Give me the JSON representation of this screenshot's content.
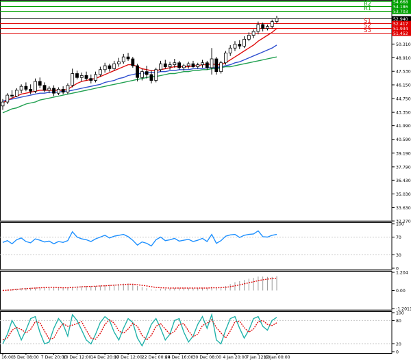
{
  "chart_data": {
    "type": "line",
    "main": {
      "type": "candlestick",
      "price_ticks": [
        "50.310",
        "48.910",
        "47.530",
        "46.150",
        "44.750",
        "43.350",
        "41.990",
        "40.590",
        "39.190",
        "37.790",
        "36.430",
        "35.030",
        "33.630",
        "32.270"
      ],
      "price_range": [
        32.27,
        54.8
      ],
      "levels": [
        {
          "name": "R3",
          "value": 54.668,
          "label": "54.668",
          "color": "#00a000"
        },
        {
          "name": "R2",
          "value": 54.186,
          "label": "54.186",
          "color": "#00a000"
        },
        {
          "name": "R1",
          "value": 53.703,
          "label": "53.703",
          "color": "#00a000"
        },
        {
          "name": "",
          "value": 52.94,
          "label": "52.940",
          "color": "#000000"
        },
        {
          "name": "S1",
          "value": 52.417,
          "label": "52.417",
          "color": "#e00000"
        },
        {
          "name": "S2",
          "value": 51.934,
          "label": "51.934",
          "color": "#e00000"
        },
        {
          "name": "S3",
          "value": 51.452,
          "label": "51.452",
          "color": "#e00000"
        }
      ],
      "candles": [
        [
          44.0,
          44.7,
          43.6,
          44.4
        ],
        [
          44.4,
          45.3,
          44.2,
          45.1
        ],
        [
          45.1,
          45.6,
          44.8,
          45.0
        ],
        [
          45.0,
          45.8,
          44.9,
          45.6
        ],
        [
          45.6,
          46.2,
          45.3,
          46.0
        ],
        [
          46.0,
          46.4,
          45.5,
          45.7
        ],
        [
          45.7,
          46.2,
          45.2,
          45.5
        ],
        [
          45.5,
          46.8,
          45.3,
          46.5
        ],
        [
          46.5,
          46.9,
          45.8,
          46.1
        ],
        [
          46.1,
          46.4,
          45.4,
          45.6
        ],
        [
          45.6,
          46.0,
          45.3,
          45.8
        ],
        [
          45.8,
          46.1,
          45.0,
          45.3
        ],
        [
          45.3,
          45.9,
          45.1,
          45.7
        ],
        [
          45.7,
          46.0,
          45.2,
          45.4
        ],
        [
          45.4,
          46.3,
          45.2,
          46.1
        ],
        [
          46.1,
          47.8,
          45.9,
          47.3
        ],
        [
          47.3,
          47.6,
          46.7,
          46.9
        ],
        [
          46.9,
          47.4,
          46.5,
          47.1
        ],
        [
          47.1,
          47.5,
          46.6,
          46.8
        ],
        [
          46.8,
          47.2,
          46.3,
          46.6
        ],
        [
          46.6,
          47.5,
          46.4,
          47.2
        ],
        [
          47.2,
          48.0,
          47.0,
          47.7
        ],
        [
          47.7,
          48.4,
          47.4,
          48.1
        ],
        [
          48.1,
          48.3,
          47.5,
          47.8
        ],
        [
          47.8,
          48.6,
          47.6,
          48.3
        ],
        [
          48.3,
          48.9,
          48.0,
          48.5
        ],
        [
          48.5,
          49.3,
          48.3,
          49.0
        ],
        [
          49.0,
          49.4,
          48.6,
          48.8
        ],
        [
          48.8,
          49.0,
          47.9,
          48.1
        ],
        [
          48.1,
          48.3,
          46.5,
          46.9
        ],
        [
          46.9,
          47.8,
          46.6,
          47.5
        ],
        [
          47.5,
          48.1,
          46.8,
          47.2
        ],
        [
          47.2,
          47.6,
          46.3,
          46.6
        ],
        [
          46.6,
          47.9,
          46.4,
          47.7
        ],
        [
          47.7,
          48.6,
          47.5,
          48.3
        ],
        [
          48.3,
          48.7,
          47.8,
          48.0
        ],
        [
          48.0,
          48.5,
          47.7,
          48.2
        ],
        [
          48.2,
          48.8,
          47.9,
          48.4
        ],
        [
          48.4,
          48.6,
          47.7,
          47.9
        ],
        [
          47.9,
          48.3,
          47.6,
          48.1
        ],
        [
          48.1,
          48.5,
          47.8,
          48.3
        ],
        [
          48.3,
          48.6,
          47.9,
          48.0
        ],
        [
          48.0,
          48.4,
          47.8,
          48.2
        ],
        [
          48.2,
          48.7,
          47.9,
          48.4
        ],
        [
          48.4,
          48.6,
          47.7,
          47.9
        ],
        [
          47.9,
          49.9,
          47.2,
          48.8
        ],
        [
          48.8,
          49.0,
          47.2,
          47.5
        ],
        [
          47.5,
          48.6,
          47.3,
          48.4
        ],
        [
          48.4,
          49.6,
          48.2,
          49.4
        ],
        [
          49.4,
          50.2,
          49.1,
          49.9
        ],
        [
          49.9,
          50.6,
          49.6,
          50.3
        ],
        [
          50.3,
          50.7,
          49.8,
          50.1
        ],
        [
          50.1,
          51.1,
          49.9,
          50.8
        ],
        [
          50.8,
          51.5,
          50.6,
          51.2
        ],
        [
          51.2,
          51.8,
          50.9,
          51.6
        ],
        [
          51.6,
          52.6,
          51.3,
          52.3
        ],
        [
          52.3,
          52.5,
          51.6,
          51.9
        ],
        [
          51.9,
          52.3,
          51.7,
          52.1
        ],
        [
          52.1,
          52.8,
          51.9,
          52.6
        ],
        [
          52.6,
          53.2,
          52.4,
          52.94
        ]
      ],
      "ma_red": [
        44.3,
        44.6,
        44.8,
        45.0,
        45.2,
        45.3,
        45.4,
        45.5,
        45.6,
        45.6,
        45.6,
        45.6,
        45.6,
        45.6,
        45.7,
        46.0,
        46.3,
        46.5,
        46.6,
        46.7,
        46.8,
        47.0,
        47.2,
        47.4,
        47.6,
        47.8,
        48.0,
        48.2,
        48.2,
        48.0,
        47.8,
        47.7,
        47.6,
        47.6,
        47.7,
        47.8,
        47.9,
        48.0,
        48.0,
        48.0,
        48.0,
        48.1,
        48.1,
        48.2,
        48.2,
        48.3,
        48.2,
        48.2,
        48.4,
        48.7,
        49.0,
        49.3,
        49.6,
        49.9,
        50.2,
        50.6,
        50.9,
        51.2,
        51.5,
        51.9
      ],
      "ma_blue": [
        44.5,
        44.6,
        44.7,
        44.8,
        44.9,
        45.0,
        45.1,
        45.2,
        45.3,
        45.3,
        45.4,
        45.4,
        45.4,
        45.5,
        45.5,
        45.6,
        45.7,
        45.8,
        45.9,
        46.0,
        46.1,
        46.2,
        46.4,
        46.5,
        46.6,
        46.8,
        46.9,
        47.1,
        47.2,
        47.3,
        47.3,
        47.4,
        47.4,
        47.4,
        47.5,
        47.5,
        47.6,
        47.6,
        47.7,
        47.7,
        47.7,
        47.8,
        47.8,
        47.8,
        47.9,
        47.9,
        47.9,
        48.0,
        48.1,
        48.2,
        48.4,
        48.5,
        48.7,
        48.9,
        49.1,
        49.3,
        49.5,
        49.7,
        49.9,
        50.2
      ],
      "ma_green": [
        43.3,
        43.5,
        43.7,
        43.8,
        44.0,
        44.2,
        44.3,
        44.4,
        44.6,
        44.7,
        44.8,
        44.9,
        45.0,
        45.1,
        45.2,
        45.3,
        45.4,
        45.5,
        45.6,
        45.7,
        45.8,
        45.9,
        46.0,
        46.1,
        46.2,
        46.3,
        46.4,
        46.5,
        46.6,
        46.7,
        46.8,
        46.9,
        47.0,
        47.0,
        47.1,
        47.2,
        47.3,
        47.3,
        47.4,
        47.5,
        47.5,
        47.6,
        47.6,
        47.7,
        47.7,
        47.8,
        47.8,
        47.9,
        48.0,
        48.0,
        48.1,
        48.2,
        48.3,
        48.4,
        48.5,
        48.6,
        48.7,
        48.8,
        48.9,
        49.0
      ]
    },
    "rsi": {
      "ticks": [
        "100",
        "70",
        "30",
        "0"
      ],
      "range": [
        0,
        100
      ],
      "values": [
        58,
        62,
        55,
        64,
        68,
        60,
        57,
        66,
        63,
        59,
        61,
        55,
        60,
        58,
        62,
        82,
        70,
        66,
        64,
        60,
        66,
        70,
        74,
        68,
        72,
        74,
        76,
        71,
        63,
        52,
        59,
        56,
        50,
        64,
        70,
        62,
        64,
        67,
        61,
        63,
        65,
        60,
        63,
        67,
        60,
        76,
        56,
        62,
        72,
        75,
        76,
        69,
        74,
        76,
        77,
        84,
        71,
        70,
        74,
        76
      ]
    },
    "macd": {
      "ticks": [
        "1.204",
        "0.00",
        "-1.2011"
      ],
      "range": [
        -1.2011,
        1.204
      ],
      "values": [
        0.02,
        0.05,
        0.08,
        0.12,
        0.15,
        0.17,
        0.18,
        0.2,
        0.22,
        0.22,
        0.21,
        0.19,
        0.18,
        0.16,
        0.16,
        0.24,
        0.28,
        0.3,
        0.3,
        0.29,
        0.3,
        0.33,
        0.36,
        0.38,
        0.4,
        0.42,
        0.45,
        0.46,
        0.42,
        0.3,
        0.22,
        0.15,
        0.06,
        0.05,
        0.1,
        0.12,
        0.14,
        0.16,
        0.15,
        0.15,
        0.16,
        0.15,
        0.16,
        0.18,
        0.16,
        0.25,
        0.18,
        0.2,
        0.3,
        0.42,
        0.55,
        0.62,
        0.7,
        0.78,
        0.84,
        0.92,
        0.92,
        0.9,
        0.9,
        0.95
      ],
      "signal": [
        0.0,
        0.02,
        0.04,
        0.07,
        0.1,
        0.12,
        0.14,
        0.16,
        0.18,
        0.19,
        0.2,
        0.2,
        0.19,
        0.18,
        0.18,
        0.2,
        0.22,
        0.24,
        0.26,
        0.27,
        0.28,
        0.3,
        0.31,
        0.33,
        0.35,
        0.37,
        0.39,
        0.41,
        0.41,
        0.38,
        0.34,
        0.3,
        0.25,
        0.2,
        0.18,
        0.17,
        0.16,
        0.16,
        0.16,
        0.16,
        0.16,
        0.16,
        0.16,
        0.16,
        0.16,
        0.18,
        0.18,
        0.19,
        0.21,
        0.25,
        0.31,
        0.37,
        0.44,
        0.51,
        0.58,
        0.65,
        0.71,
        0.75,
        0.79,
        0.82
      ]
    },
    "stochastic": {
      "ticks": [
        "100",
        "80",
        "20",
        "0"
      ],
      "range": [
        0,
        100
      ],
      "k": [
        20,
        45,
        80,
        60,
        30,
        55,
        85,
        90,
        50,
        20,
        25,
        60,
        85,
        70,
        40,
        95,
        80,
        55,
        30,
        20,
        45,
        75,
        90,
        80,
        50,
        30,
        60,
        85,
        75,
        35,
        15,
        40,
        70,
        85,
        60,
        30,
        45,
        80,
        85,
        50,
        25,
        40,
        70,
        90,
        60,
        95,
        30,
        20,
        55,
        85,
        90,
        60,
        35,
        55,
        85,
        90,
        65,
        55,
        80,
        88
      ],
      "d": [
        30,
        35,
        55,
        62,
        57,
        48,
        57,
        77,
        75,
        53,
        32,
        35,
        57,
        72,
        65,
        68,
        72,
        77,
        55,
        35,
        32,
        47,
        70,
        82,
        73,
        53,
        47,
        58,
        73,
        65,
        42,
        30,
        42,
        65,
        72,
        58,
        45,
        52,
        70,
        72,
        53,
        38,
        45,
        67,
        73,
        82,
        62,
        48,
        35,
        53,
        77,
        78,
        62,
        50,
        58,
        77,
        80,
        70,
        67,
        74
      ]
    },
    "time_labels": [
      "16:00",
      "3 Dec 08:00",
      "7 Dec 20:00",
      "10 Dec 12:00",
      "14 Dec 20:00",
      "17 Dec 12:00",
      "22 Dec 00:00",
      "24 Dec 16:00",
      "30 Dec 08:00",
      "4 Jan 20:00",
      "7 Jan 12:00",
      "12 Jan 00:00"
    ],
    "time_label_index": [
      0,
      5,
      11,
      16,
      22,
      27,
      33,
      38,
      44,
      50,
      55,
      59
    ]
  }
}
